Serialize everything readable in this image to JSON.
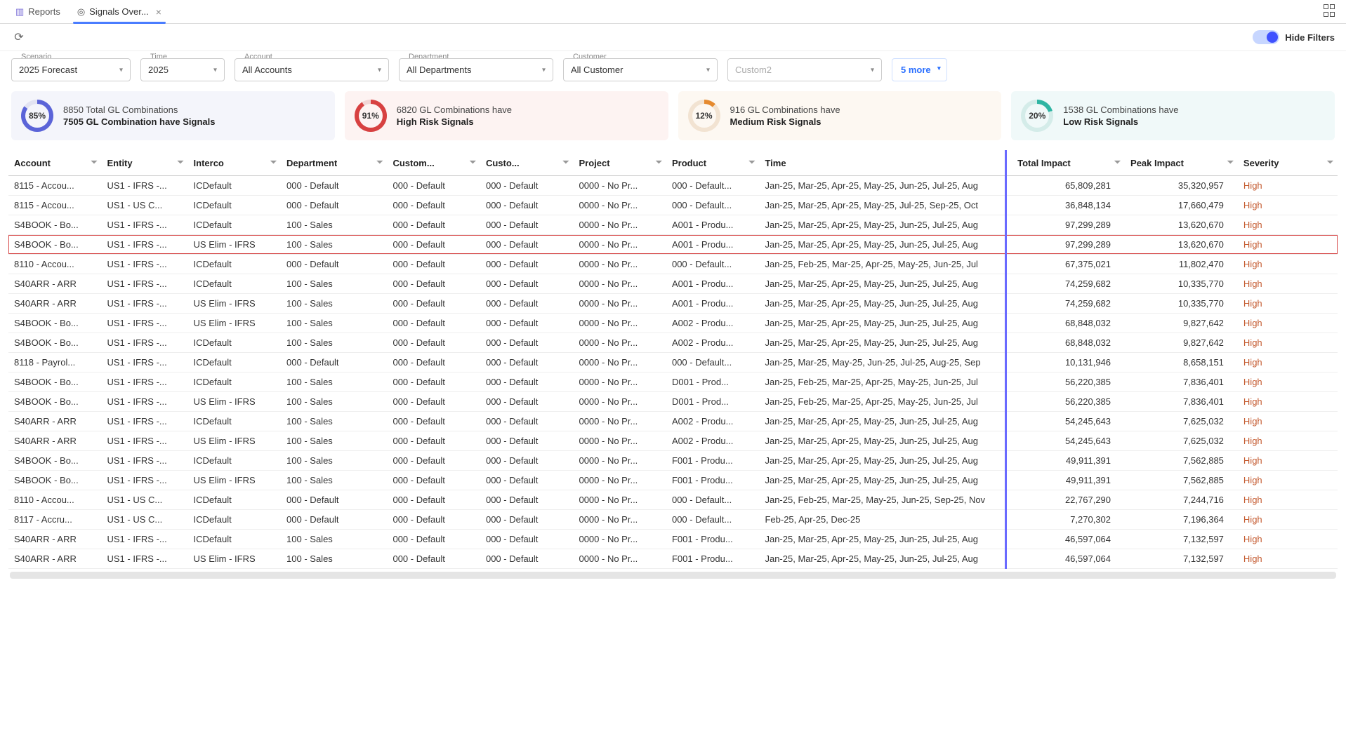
{
  "tabs": {
    "reports": "Reports",
    "signals": "Signals Over..."
  },
  "toolbar": {
    "hide_filters": "Hide Filters"
  },
  "filters": {
    "scenario": {
      "label": "Scenario",
      "value": "2025 Forecast"
    },
    "time": {
      "label": "Time",
      "value": "2025"
    },
    "account": {
      "label": "Account",
      "value": "All Accounts"
    },
    "department": {
      "label": "Department",
      "value": "All Departments"
    },
    "customer": {
      "label": "Customer",
      "value": "All Customer"
    },
    "custom2": {
      "placeholder": "Custom2"
    },
    "more": "5 more"
  },
  "kpi": {
    "total": {
      "pct": "85%",
      "line1": "8850 Total GL Combinations",
      "line2": "7505 GL Combination have Signals"
    },
    "high": {
      "pct": "91%",
      "line1": "6820 GL Combinations have",
      "line2": "High Risk Signals"
    },
    "med": {
      "pct": "12%",
      "line1": "916 GL Combinations have",
      "line2": "Medium Risk Signals"
    },
    "low": {
      "pct": "20%",
      "line1": "1538 GL Combinations have",
      "line2": "Low Risk Signals"
    }
  },
  "columns": [
    "Account",
    "Entity",
    "Interco",
    "Department",
    "Custom...",
    "Custo...",
    "Project",
    "Product",
    "Time",
    "Total Impact",
    "Peak Impact",
    "Severity"
  ],
  "rows": [
    {
      "account": "8115 - Accou...",
      "entity": "US1 - IFRS -...",
      "interco": "ICDefault",
      "dept": "000 - Default",
      "c1": "000 - Default",
      "c2": "000 - Default",
      "project": "0000 - No Pr...",
      "product": "000 - Default...",
      "time": "Jan-25, Mar-25, Apr-25, May-25, Jun-25, Jul-25, Aug",
      "total": "65,809,281",
      "peak": "35,320,957",
      "sev": "High"
    },
    {
      "account": "8115 - Accou...",
      "entity": "US1 - US C...",
      "interco": "ICDefault",
      "dept": "000 - Default",
      "c1": "000 - Default",
      "c2": "000 - Default",
      "project": "0000 - No Pr...",
      "product": "000 - Default...",
      "time": "Jan-25, Mar-25, Apr-25, May-25, Jul-25, Sep-25, Oct",
      "total": "36,848,134",
      "peak": "17,660,479",
      "sev": "High"
    },
    {
      "account": "S4BOOK - Bo...",
      "entity": "US1 - IFRS -...",
      "interco": "ICDefault",
      "dept": "100 - Sales",
      "c1": "000 - Default",
      "c2": "000 - Default",
      "project": "0000 - No Pr...",
      "product": "A001 - Produ...",
      "time": "Jan-25, Mar-25, Apr-25, May-25, Jun-25, Jul-25, Aug",
      "total": "97,299,289",
      "peak": "13,620,670",
      "sev": "High"
    },
    {
      "account": "S4BOOK - Bo...",
      "entity": "US1 - IFRS -...",
      "interco": "US Elim - IFRS",
      "dept": "100 - Sales",
      "c1": "000 - Default",
      "c2": "000 - Default",
      "project": "0000 - No Pr...",
      "product": "A001 - Produ...",
      "time": "Jan-25, Mar-25, Apr-25, May-25, Jun-25, Jul-25, Aug",
      "total": "97,299,289",
      "peak": "13,620,670",
      "sev": "High",
      "highlight": true
    },
    {
      "account": "8110 - Accou...",
      "entity": "US1 - IFRS -...",
      "interco": "ICDefault",
      "dept": "000 - Default",
      "c1": "000 - Default",
      "c2": "000 - Default",
      "project": "0000 - No Pr...",
      "product": "000 - Default...",
      "time": "Jan-25, Feb-25, Mar-25, Apr-25, May-25, Jun-25, Jul",
      "total": "67,375,021",
      "peak": "11,802,470",
      "sev": "High"
    },
    {
      "account": "S40ARR - ARR",
      "entity": "US1 - IFRS -...",
      "interco": "ICDefault",
      "dept": "100 - Sales",
      "c1": "000 - Default",
      "c2": "000 - Default",
      "project": "0000 - No Pr...",
      "product": "A001 - Produ...",
      "time": "Jan-25, Mar-25, Apr-25, May-25, Jun-25, Jul-25, Aug",
      "total": "74,259,682",
      "peak": "10,335,770",
      "sev": "High"
    },
    {
      "account": "S40ARR - ARR",
      "entity": "US1 - IFRS -...",
      "interco": "US Elim - IFRS",
      "dept": "100 - Sales",
      "c1": "000 - Default",
      "c2": "000 - Default",
      "project": "0000 - No Pr...",
      "product": "A001 - Produ...",
      "time": "Jan-25, Mar-25, Apr-25, May-25, Jun-25, Jul-25, Aug",
      "total": "74,259,682",
      "peak": "10,335,770",
      "sev": "High"
    },
    {
      "account": "S4BOOK - Bo...",
      "entity": "US1 - IFRS -...",
      "interco": "US Elim - IFRS",
      "dept": "100 - Sales",
      "c1": "000 - Default",
      "c2": "000 - Default",
      "project": "0000 - No Pr...",
      "product": "A002 - Produ...",
      "time": "Jan-25, Mar-25, Apr-25, May-25, Jun-25, Jul-25, Aug",
      "total": "68,848,032",
      "peak": "9,827,642",
      "sev": "High"
    },
    {
      "account": "S4BOOK - Bo...",
      "entity": "US1 - IFRS -...",
      "interco": "ICDefault",
      "dept": "100 - Sales",
      "c1": "000 - Default",
      "c2": "000 - Default",
      "project": "0000 - No Pr...",
      "product": "A002 - Produ...",
      "time": "Jan-25, Mar-25, Apr-25, May-25, Jun-25, Jul-25, Aug",
      "total": "68,848,032",
      "peak": "9,827,642",
      "sev": "High"
    },
    {
      "account": "8118 - Payrol...",
      "entity": "US1 - IFRS -...",
      "interco": "ICDefault",
      "dept": "000 - Default",
      "c1": "000 - Default",
      "c2": "000 - Default",
      "project": "0000 - No Pr...",
      "product": "000 - Default...",
      "time": "Jan-25, Mar-25, May-25, Jun-25, Jul-25, Aug-25, Sep",
      "total": "10,131,946",
      "peak": "8,658,151",
      "sev": "High"
    },
    {
      "account": "S4BOOK - Bo...",
      "entity": "US1 - IFRS -...",
      "interco": "ICDefault",
      "dept": "100 - Sales",
      "c1": "000 - Default",
      "c2": "000 - Default",
      "project": "0000 - No Pr...",
      "product": "D001 - Prod...",
      "time": "Jan-25, Feb-25, Mar-25, Apr-25, May-25, Jun-25, Jul",
      "total": "56,220,385",
      "peak": "7,836,401",
      "sev": "High"
    },
    {
      "account": "S4BOOK - Bo...",
      "entity": "US1 - IFRS -...",
      "interco": "US Elim - IFRS",
      "dept": "100 - Sales",
      "c1": "000 - Default",
      "c2": "000 - Default",
      "project": "0000 - No Pr...",
      "product": "D001 - Prod...",
      "time": "Jan-25, Feb-25, Mar-25, Apr-25, May-25, Jun-25, Jul",
      "total": "56,220,385",
      "peak": "7,836,401",
      "sev": "High"
    },
    {
      "account": "S40ARR - ARR",
      "entity": "US1 - IFRS -...",
      "interco": "ICDefault",
      "dept": "100 - Sales",
      "c1": "000 - Default",
      "c2": "000 - Default",
      "project": "0000 - No Pr...",
      "product": "A002 - Produ...",
      "time": "Jan-25, Mar-25, Apr-25, May-25, Jun-25, Jul-25, Aug",
      "total": "54,245,643",
      "peak": "7,625,032",
      "sev": "High"
    },
    {
      "account": "S40ARR - ARR",
      "entity": "US1 - IFRS -...",
      "interco": "US Elim - IFRS",
      "dept": "100 - Sales",
      "c1": "000 - Default",
      "c2": "000 - Default",
      "project": "0000 - No Pr...",
      "product": "A002 - Produ...",
      "time": "Jan-25, Mar-25, Apr-25, May-25, Jun-25, Jul-25, Aug",
      "total": "54,245,643",
      "peak": "7,625,032",
      "sev": "High"
    },
    {
      "account": "S4BOOK - Bo...",
      "entity": "US1 - IFRS -...",
      "interco": "ICDefault",
      "dept": "100 - Sales",
      "c1": "000 - Default",
      "c2": "000 - Default",
      "project": "0000 - No Pr...",
      "product": "F001 - Produ...",
      "time": "Jan-25, Mar-25, Apr-25, May-25, Jun-25, Jul-25, Aug",
      "total": "49,911,391",
      "peak": "7,562,885",
      "sev": "High"
    },
    {
      "account": "S4BOOK - Bo...",
      "entity": "US1 - IFRS -...",
      "interco": "US Elim - IFRS",
      "dept": "100 - Sales",
      "c1": "000 - Default",
      "c2": "000 - Default",
      "project": "0000 - No Pr...",
      "product": "F001 - Produ...",
      "time": "Jan-25, Mar-25, Apr-25, May-25, Jun-25, Jul-25, Aug",
      "total": "49,911,391",
      "peak": "7,562,885",
      "sev": "High"
    },
    {
      "account": "8110 - Accou...",
      "entity": "US1 - US C...",
      "interco": "ICDefault",
      "dept": "000 - Default",
      "c1": "000 - Default",
      "c2": "000 - Default",
      "project": "0000 - No Pr...",
      "product": "000 - Default...",
      "time": "Jan-25, Feb-25, Mar-25, May-25, Jun-25, Sep-25, Nov",
      "total": "22,767,290",
      "peak": "7,244,716",
      "sev": "High"
    },
    {
      "account": "8117 - Accru...",
      "entity": "US1 - US C...",
      "interco": "ICDefault",
      "dept": "000 - Default",
      "c1": "000 - Default",
      "c2": "000 - Default",
      "project": "0000 - No Pr...",
      "product": "000 - Default...",
      "time": "Feb-25, Apr-25, Dec-25",
      "total": "7,270,302",
      "peak": "7,196,364",
      "sev": "High"
    },
    {
      "account": "S40ARR - ARR",
      "entity": "US1 - IFRS -...",
      "interco": "ICDefault",
      "dept": "100 - Sales",
      "c1": "000 - Default",
      "c2": "000 - Default",
      "project": "0000 - No Pr...",
      "product": "F001 - Produ...",
      "time": "Jan-25, Mar-25, Apr-25, May-25, Jun-25, Jul-25, Aug",
      "total": "46,597,064",
      "peak": "7,132,597",
      "sev": "High"
    },
    {
      "account": "S40ARR - ARR",
      "entity": "US1 - IFRS -...",
      "interco": "US Elim - IFRS",
      "dept": "100 - Sales",
      "c1": "000 - Default",
      "c2": "000 - Default",
      "project": "0000 - No Pr...",
      "product": "F001 - Produ...",
      "time": "Jan-25, Mar-25, Apr-25, May-25, Jun-25, Jul-25, Aug",
      "total": "46,597,064",
      "peak": "7,132,597",
      "sev": "High"
    }
  ]
}
